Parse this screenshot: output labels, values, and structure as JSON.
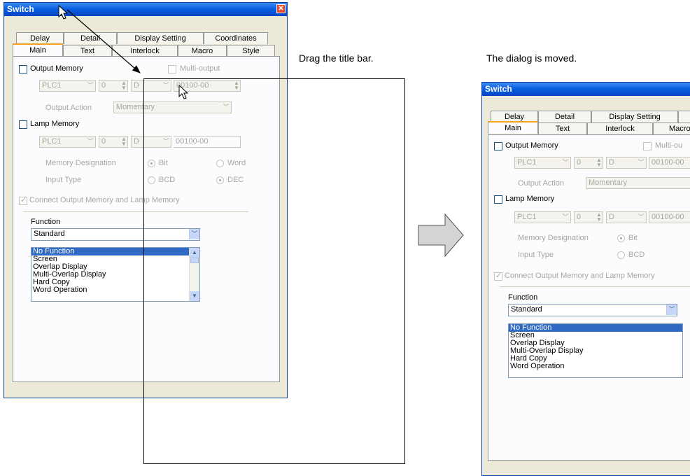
{
  "dialog": {
    "title": "Switch",
    "close_glyph": "✕",
    "tabs_back": [
      "Delay",
      "Detail",
      "Display Setting",
      "Coordinates"
    ],
    "tabs_front": [
      "Main",
      "Text",
      "Interlock",
      "Macro",
      "Style"
    ],
    "output_memory_label": "Output Memory",
    "multi_output_label": "Multi-output",
    "multi_output_truncated": "Multi-ou",
    "plc": "PLC1",
    "number": "0",
    "device": "D",
    "address": "00100-00",
    "output_action_label": "Output Action",
    "output_action_value": "Momentary",
    "lamp_memory_label": "Lamp Memory",
    "memory_designation_label": "Memory Designation",
    "bit_label": "Bit",
    "word_label": "Word",
    "input_type_label": "Input Type",
    "bcd_label": "BCD",
    "dec_label": "DEC",
    "connect_label": "Connect Output Memory and Lamp Memory",
    "function_label": "Function",
    "function_value": "Standard",
    "function_items": [
      "No Function",
      "Screen",
      "Overlap Display",
      "Multi-Overlap Display",
      "Hard Copy",
      "Word Operation"
    ],
    "selected_function_index": 0
  },
  "captions": {
    "left": "Drag the title bar.",
    "right": "The dialog is moved."
  },
  "icons": {
    "cursor": "mouse-pointer-icon",
    "arrow": "right-arrow-icon"
  }
}
